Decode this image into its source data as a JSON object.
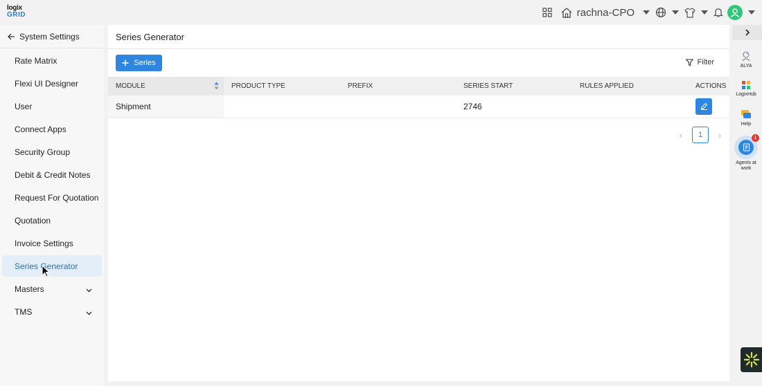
{
  "brand": {
    "logo_line1": "logix",
    "logo_line2": "GRID"
  },
  "topbar": {
    "workspace": "rachna-CPO"
  },
  "sidebar": {
    "back_label": "System Settings",
    "items": [
      {
        "label": "Rate Matrix"
      },
      {
        "label": "Flexi UI Designer"
      },
      {
        "label": "User"
      },
      {
        "label": "Connect Apps"
      },
      {
        "label": "Security Group"
      },
      {
        "label": "Debit & Credit Notes"
      },
      {
        "label": "Request For Quotation"
      },
      {
        "label": "Quotation"
      },
      {
        "label": "Invoice Settings"
      },
      {
        "label": "Series Generator",
        "active": true
      },
      {
        "label": "Masters",
        "expandable": true
      },
      {
        "label": "TMS",
        "expandable": true
      }
    ]
  },
  "main": {
    "title": "Series Generator",
    "add_button_label": "Series",
    "filter_label": "Filter",
    "columns": [
      "MODULE",
      "PRODUCT TYPE",
      "PREFIX",
      "SERIES START",
      "RULES APPLIED",
      "ACTIONS"
    ],
    "rows": [
      {
        "module": "Shipment",
        "product_type": "",
        "prefix": "",
        "series_start": "2746",
        "rules_applied": ""
      }
    ],
    "pagination": {
      "current_page": "1"
    }
  },
  "rail": {
    "alya": "ALYA",
    "logixhub": "LogixHub",
    "help": "Help",
    "agents_line1": "Agents at",
    "agents_line2": "work",
    "agents_badge": "1"
  },
  "colors": {
    "accent": "#2f86e0",
    "active_bg": "#e4eef9",
    "avatar": "#2ec77a",
    "badge": "#e53935"
  }
}
